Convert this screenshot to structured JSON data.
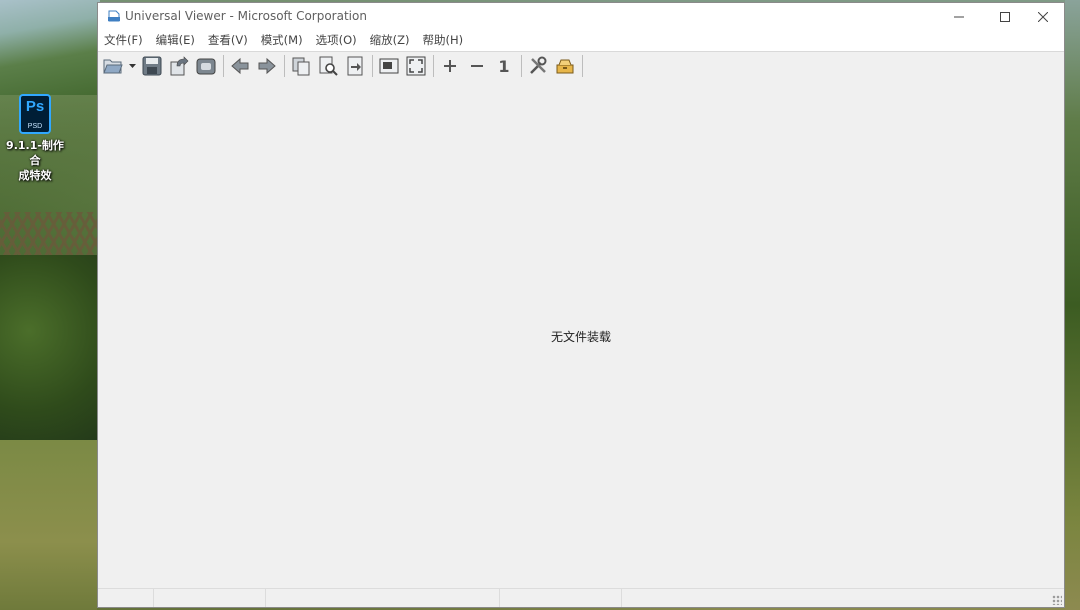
{
  "desktop": {
    "icon_badge": "Ps",
    "icon_sub": "PSD",
    "icon_label_line1": "9.1.1-制作合",
    "icon_label_line2": "成特效"
  },
  "window": {
    "title": "Universal Viewer - Microsoft Corporation",
    "controls": {
      "minimize": "—",
      "maximize": "☐",
      "close": "✕"
    }
  },
  "menu": [
    "文件(F)",
    "编辑(E)",
    "查看(V)",
    "模式(M)",
    "选项(O)",
    "缩放(Z)",
    "帮助(H)"
  ],
  "toolbar": {
    "icons": [
      "open-icon",
      "save-icon",
      "reload-icon",
      "print-icon",
      "back-icon",
      "forward-icon",
      "copy-icon",
      "find-icon",
      "goto-icon",
      "fit-window-icon",
      "fullscreen-icon",
      "zoom-in-icon",
      "zoom-out-icon",
      "actual-size-icon",
      "tools-icon",
      "plugin-icon"
    ],
    "zoom_in": "+",
    "zoom_out": "−",
    "actual_size": "1"
  },
  "content": {
    "empty_message": "无文件装载"
  },
  "colors": {
    "window_bg": "#f0f0f0",
    "title_text": "#606060",
    "accent_ps": "#31a8ff"
  }
}
